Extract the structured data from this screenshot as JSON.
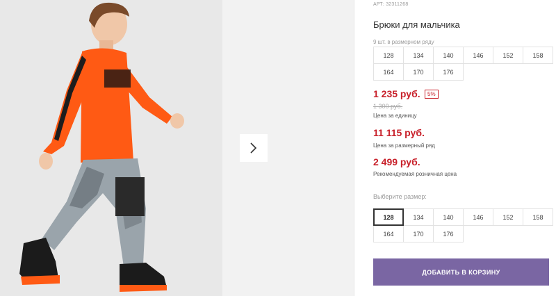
{
  "product": {
    "article": "АРТ: 32311268",
    "title": "Брюки для мальчика",
    "pack_note": "9 шт. в размерном ряду",
    "pack_sizes": [
      "128",
      "134",
      "140",
      "146",
      "152",
      "158",
      "164",
      "170",
      "176"
    ],
    "price": "1 235 руб.",
    "discount": "5%",
    "old_price": "1 300 руб.",
    "unit_price_label": "Цена за единицу",
    "pack_price": "11 115 руб.",
    "pack_price_label": "Цена за размерный ряд",
    "rrp": "2 499 руб.",
    "rrp_label": "Рекомендуемая розничная цена",
    "choose_size_label": "Выберите размер:",
    "sizes": [
      "128",
      "134",
      "140",
      "146",
      "152",
      "158",
      "164",
      "170",
      "176"
    ],
    "selected_size": "128",
    "add_to_cart_label": "ДОБАВИТЬ В КОРЗИНУ"
  },
  "gallery": {
    "next_icon": "chevron-right-icon"
  },
  "colors": {
    "price_red": "#c8202a",
    "button_purple": "#7a66a3",
    "shirt_orange": "#ff5a14"
  }
}
